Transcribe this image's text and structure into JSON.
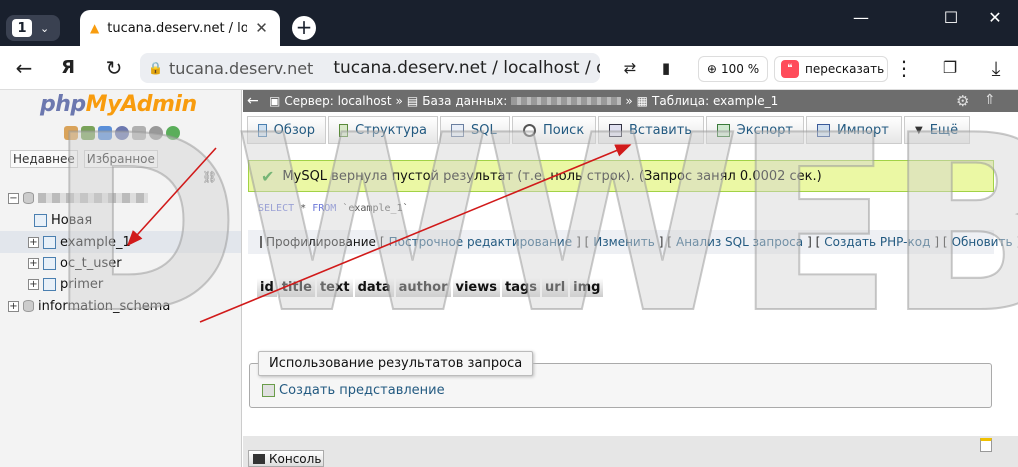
{
  "browser": {
    "tab_count": "1",
    "tab_title": "tucana.deserv.net / localhost / dw",
    "tab_close": "✕",
    "url_domain": "tucana.deserv.net",
    "url_path": "tucana.deserv.net / localhost / dw...",
    "zoom": "100 %",
    "retell": "пересказать",
    "yandex_icon": "Я"
  },
  "sidebar": {
    "logo_php": "php",
    "logo_myadmin": "MyAdmin",
    "tab_recent": "Недавнее",
    "tab_favorites": "Избранное",
    "tree": [
      {
        "label": "Новая"
      },
      {
        "label": "example_1"
      },
      {
        "label": "oc_t_user"
      },
      {
        "label": "primer"
      },
      {
        "label": "information_schema"
      }
    ]
  },
  "breadcrumb": {
    "server": "Сервер: localhost",
    "database": "База данных:",
    "table": "Таблица: example_1"
  },
  "menu": {
    "browse": "Обзор",
    "structure": "Структура",
    "sql": "SQL",
    "search": "Поиск",
    "insert": "Вставить",
    "export": "Экспорт",
    "import": "Импорт",
    "more": "Ещё"
  },
  "result": {
    "message": "MySQL вернула пустой результат (т.е. ноль строк). (Запрос занял 0.0002 сек.)",
    "sql_select": "SELECT",
    "sql_star": "*",
    "sql_from": "FROM",
    "sql_table": "`example_1`"
  },
  "profiling": {
    "label": "Профилирование",
    "inline_edit": "Построчное редактирование",
    "edit": "Изменить",
    "analyze": "Анализ SQL запроса",
    "create_php": "Создать PHP-код",
    "refresh": "Обновить"
  },
  "columns": [
    "id",
    "title",
    "text",
    "data",
    "author",
    "views",
    "tags",
    "url",
    "img"
  ],
  "query_results": {
    "legend": "Использование результатов запроса",
    "create_view": "Создать представление"
  },
  "console": {
    "label": "Консоль"
  },
  "watermark": {
    "text": "DWWEB.RU"
  },
  "colors": {
    "link": "#235a81",
    "success_bg": "#ebf8a4",
    "arrow": "#d11a1a"
  }
}
